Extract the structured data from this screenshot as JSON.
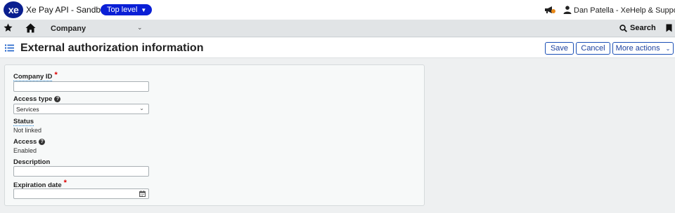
{
  "app": {
    "logo_text": "xe",
    "title": "Xe Pay API - Sandbox",
    "entity_label": "Top level",
    "user_name": "Dan Patella - Xe",
    "help_label": "Help & Support"
  },
  "nav": {
    "module_label": "Company",
    "search_label": "Search"
  },
  "header": {
    "title": "External authorization information",
    "save_label": "Save",
    "cancel_label": "Cancel",
    "more_actions_label": "More actions"
  },
  "form": {
    "company_id": {
      "label": "Company ID",
      "required": "*",
      "value": ""
    },
    "access_type": {
      "label": "Access type",
      "value": "Services",
      "help_icon": "question-circle-icon"
    },
    "status": {
      "label": "Status",
      "value": "Not linked"
    },
    "access": {
      "label": "Access",
      "value": "Enabled",
      "help_icon": "question-circle-icon"
    },
    "description": {
      "label": "Description",
      "value": ""
    },
    "expiration_date": {
      "label": "Expiration date",
      "required": "*",
      "value": ""
    }
  },
  "colors": {
    "brand": "#0a1f8f",
    "entity_pill": "#0a1fd6",
    "button_border": "#1a4fb5",
    "required": "#dd0000"
  }
}
